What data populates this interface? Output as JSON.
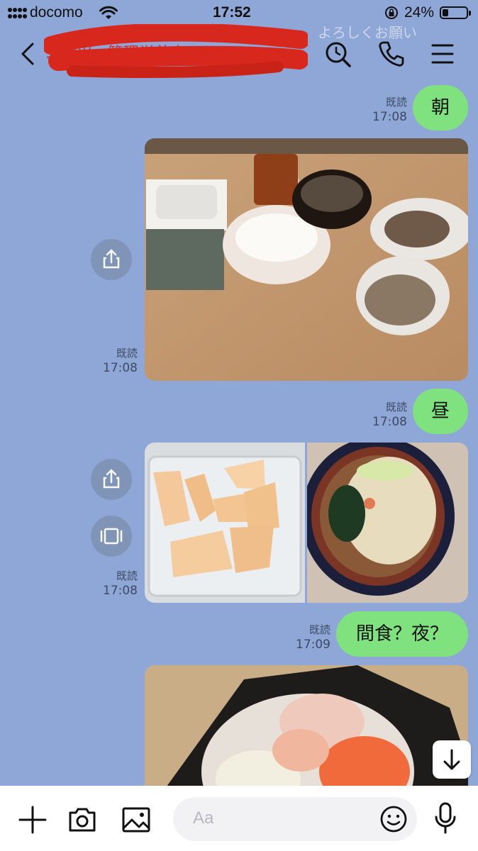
{
  "status_bar": {
    "carrier": "docomo",
    "time": "17:52",
    "battery_percent": "24%",
    "battery_level": 0.24
  },
  "header": {
    "chat_title": "…活用…管理栄養士",
    "faint_text": "よろしくお願い",
    "icons": [
      "back-chevron-icon",
      "search-icon",
      "phone-icon",
      "menu-icon"
    ]
  },
  "messages": [
    {
      "type": "text",
      "text": "朝",
      "read": "既読",
      "time": "17:08"
    },
    {
      "type": "photo",
      "subject": "breakfast",
      "read": "既読",
      "time": "17:08"
    },
    {
      "type": "text",
      "text": "昼",
      "read": "既読",
      "time": "17:08"
    },
    {
      "type": "photo-pair",
      "subject": "melon and udon",
      "read": "既読",
      "time": "17:08"
    },
    {
      "type": "text",
      "text": "間食？夜？",
      "read": "既読",
      "time": "17:09"
    },
    {
      "type": "photo",
      "subject": "sashimi rice bowl"
    }
  ],
  "input_bar": {
    "placeholder": "Aa",
    "icons": [
      "plus-icon",
      "camera-icon",
      "image-icon",
      "emoji-icon",
      "mic-icon"
    ]
  },
  "colors": {
    "background": "#8fa7d6",
    "bubble": "#7fe27e",
    "redaction": "#d8281d"
  }
}
